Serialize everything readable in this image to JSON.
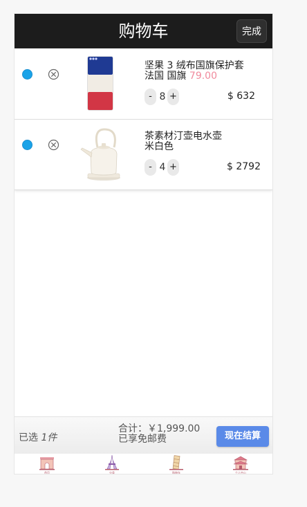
{
  "header": {
    "title": "购物车",
    "done_label": "完成"
  },
  "items": [
    {
      "name": "坚果 3 绒布国旗保护套",
      "variant": "法国 国旗",
      "unit_price": "79.00",
      "quantity": "8",
      "total": "$ 632",
      "minus": "-",
      "plus": "+",
      "image": "france-flag-phone-case"
    },
    {
      "name": "茶素材汀壶电水壶",
      "variant": "米白色",
      "quantity": "4",
      "total": "$ 2792",
      "minus": "-",
      "plus": "+",
      "image": "electric-kettle"
    }
  ],
  "footer": {
    "selected_prefix": "已选",
    "selected_count": "1件",
    "sum_label": "合计：￥1,999.00",
    "shipping_note": "已享免邮费",
    "checkout_label": "现在结算"
  },
  "tabbar": [
    {
      "icon": "arc-de-triomphe-icon",
      "label": "首页"
    },
    {
      "icon": "eiffel-tower-icon",
      "label": "分类"
    },
    {
      "icon": "leaning-tower-icon",
      "label": "购物车"
    },
    {
      "icon": "temple-icon",
      "label": "个人中心"
    }
  ],
  "colors": {
    "header_bg": "#1c1c1c",
    "radio": "#1aa3e8",
    "price": "#f08a9d",
    "checkout": "#5a8ae8"
  }
}
